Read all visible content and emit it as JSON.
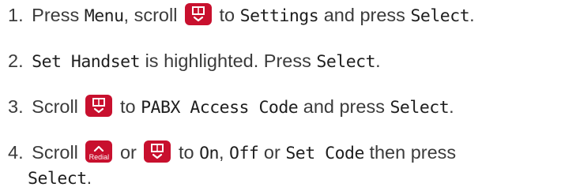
{
  "steps": [
    {
      "number": "1.",
      "text_a": "Press",
      "menu": "Menu",
      "text_b": ", scroll",
      "text_c": "to",
      "settings": "Settings",
      "text_d": "and press",
      "select": "Select",
      "end": "."
    },
    {
      "number": "2.",
      "set_handset": "Set Handset",
      "text_a": "is highlighted. Press",
      "select": "Select",
      "end": "."
    },
    {
      "number": "3.",
      "text_a": "Scroll",
      "text_b": "to",
      "pabx": "PABX Access Code",
      "text_c": "and press",
      "select": "Select",
      "end": "."
    },
    {
      "number": "4.",
      "text_a": "Scroll",
      "text_b": "or",
      "text_c": "to",
      "on": "On",
      "comma": ",",
      "off": "Off",
      "text_d": "or",
      "set_code": "Set Code",
      "text_e": "then press",
      "select": "Select",
      "end": "."
    }
  ],
  "keys": {
    "phonebook_scroll_icon": "phonebook-down-key",
    "redial_up_icon": "redial-up-key",
    "redial_label": "Redial",
    "key_color": "#c8102e",
    "text_color": "#3b3b3b"
  }
}
